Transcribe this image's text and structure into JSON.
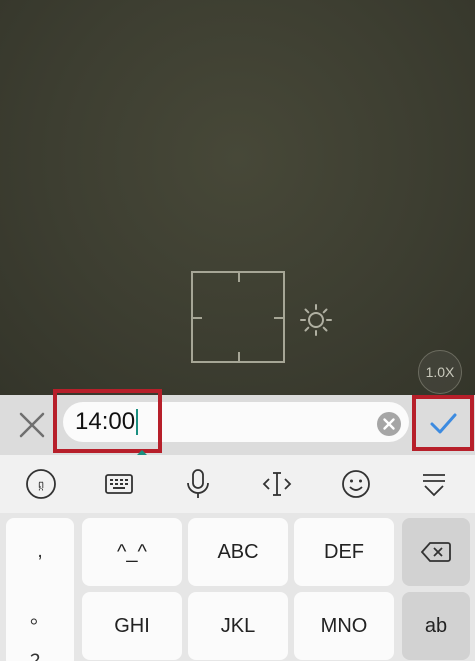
{
  "viewfinder": {
    "zoom_label": "1.0X"
  },
  "input_bar": {
    "value": "14:00"
  },
  "keyboard": {
    "punctuation": [
      ",",
      "。",
      "？"
    ],
    "row1": [
      "^_^",
      "ABC",
      "DEF"
    ],
    "row2": [
      "GHI",
      "JKL",
      "MNO"
    ],
    "switch_label": "ab"
  },
  "colors": {
    "highlight": "#b71f2a",
    "accent": "#1a8f80",
    "confirm": "#3d8be0"
  },
  "icons": [
    "close-icon",
    "clear-icon",
    "checkmark-icon",
    "keyboard-switch-icon",
    "keyboard-icon",
    "microphone-icon",
    "cursor-icon",
    "emoji-icon",
    "collapse-icon",
    "backspace-icon",
    "brightness-icon"
  ]
}
